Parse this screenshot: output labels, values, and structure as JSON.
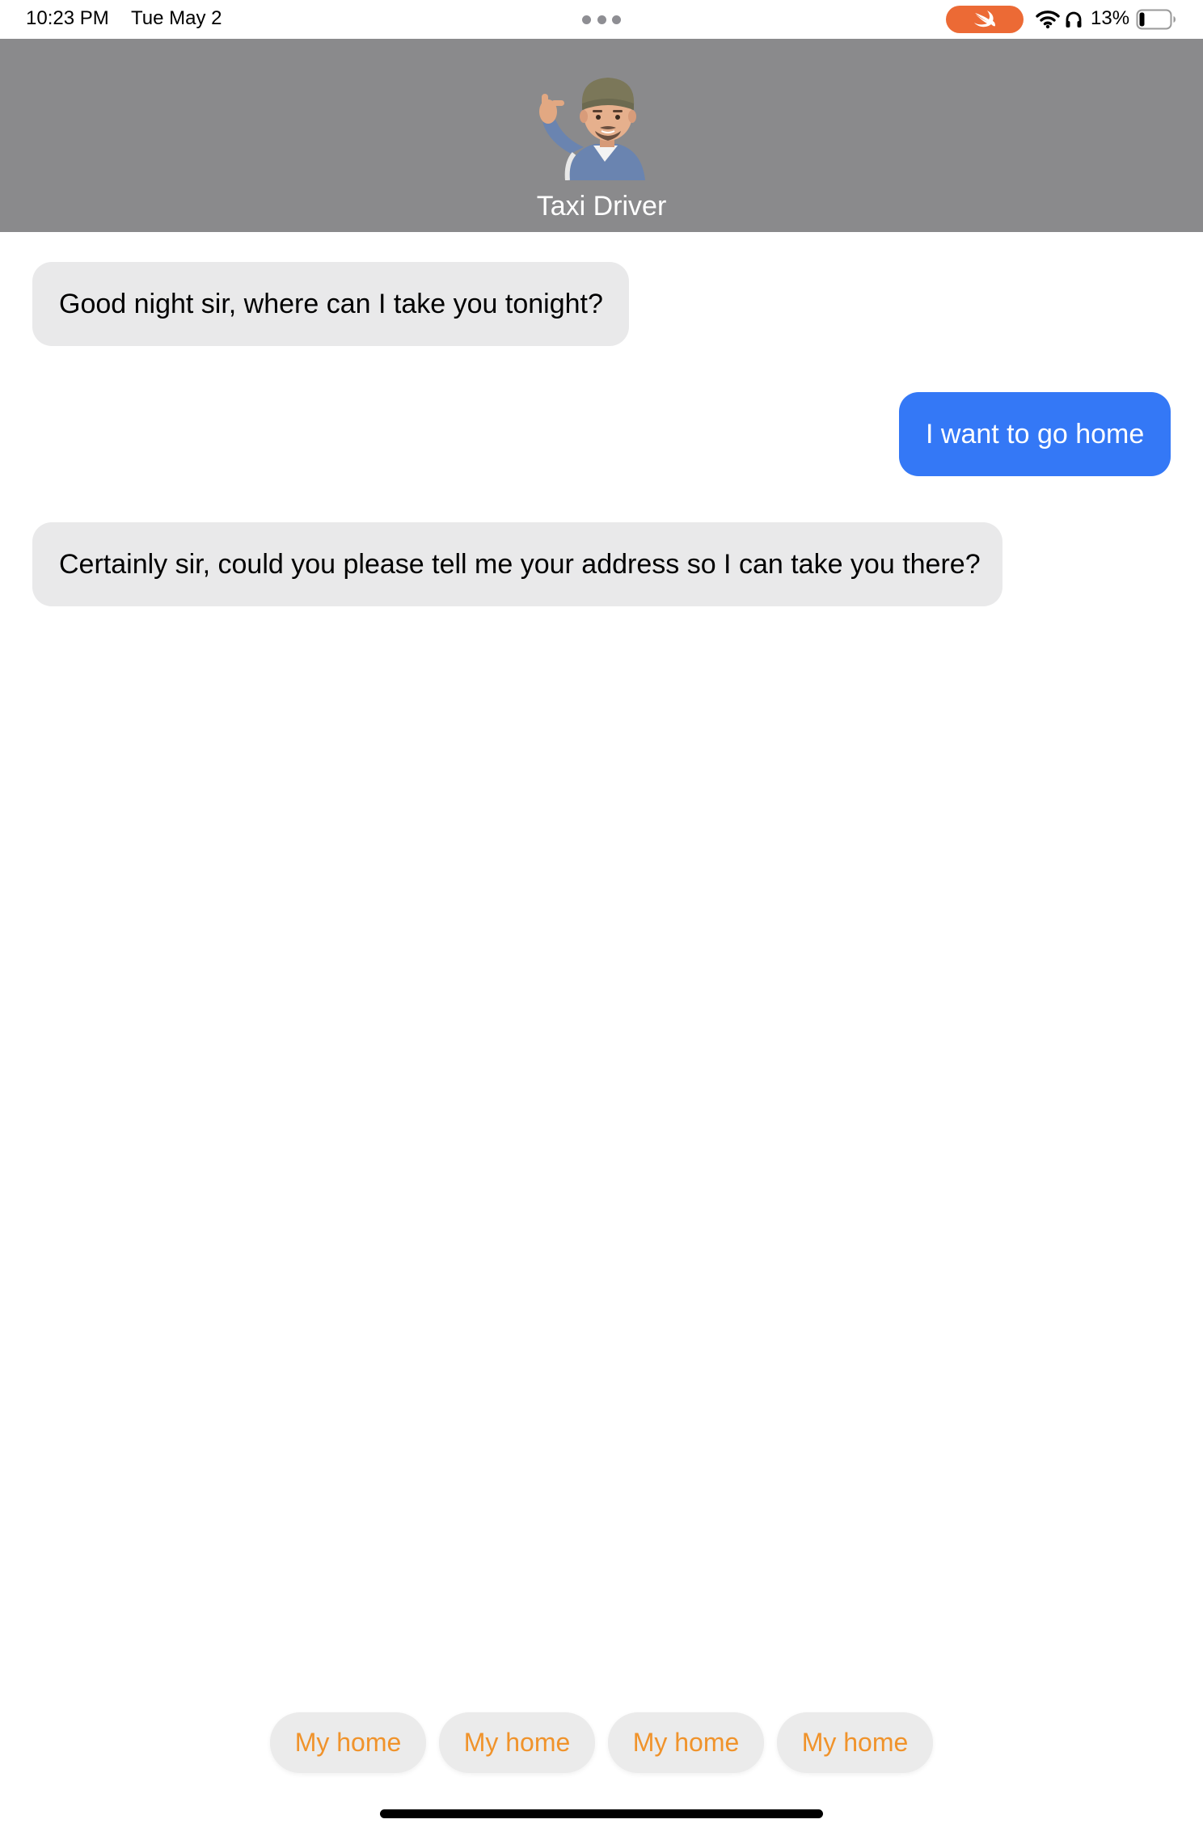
{
  "status_bar": {
    "time": "10:23 PM",
    "date": "Tue May 2",
    "battery_percent": "13%",
    "battery_level": 0.13,
    "swift_pill_color": "#ec6a35",
    "icons": [
      "multitask-dots-icon",
      "swift-icon",
      "wifi-icon",
      "headphones-icon",
      "battery-icon"
    ]
  },
  "header": {
    "title": "Taxi Driver",
    "avatar_icon": "memoji-avatar-icon",
    "background": "#8a8a8c"
  },
  "messages": [
    {
      "sender": "driver",
      "text": "Good night sir, where can I take you tonight?"
    },
    {
      "sender": "user",
      "text": "I want to go home"
    },
    {
      "sender": "driver",
      "text": "Certainly sir, could you please tell me your address so I can take you there?"
    }
  ],
  "quick_replies": [
    {
      "label": "My home"
    },
    {
      "label": "My home"
    },
    {
      "label": "My home"
    },
    {
      "label": "My home"
    }
  ],
  "colors": {
    "outgoing_bubble": "#3478f6",
    "incoming_bubble": "#e9e9ea",
    "quick_reply_text": "#f0932b"
  }
}
